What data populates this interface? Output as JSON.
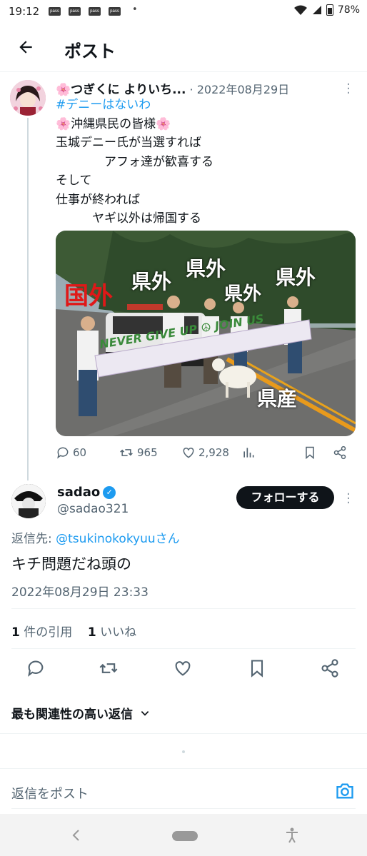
{
  "status_bar": {
    "time": "19:12",
    "notification_icons": [
      "pass",
      "pass",
      "pass",
      "pass"
    ],
    "dot": "•",
    "battery": "78%"
  },
  "header": {
    "title": "ポスト"
  },
  "tweet1": {
    "emoji": "🌸",
    "name": "つぎくに よりいち...",
    "separator": " · ",
    "date": "2022年08月29日",
    "lines": [
      "#デニーはないわ",
      "🌸沖縄県民の皆様🌸",
      "玉城デニー氏が当選すれば",
      "　　　　アフォ達が歓喜する",
      "そして",
      "仕事が終われば",
      "　　　ヤギ以外は帰国する"
    ],
    "photo": {
      "label_red": "国外",
      "labels_white": [
        "県外",
        "県外",
        "県外",
        "県外"
      ],
      "label_bottom": "県産",
      "banner": "NEVER GIVE UP ☮ JOIN US"
    },
    "stats": {
      "replies": "60",
      "reposts": "965",
      "likes": "2,928"
    }
  },
  "tweet2": {
    "name": "sadao",
    "handle": "@sadao321",
    "follow_label": "フォローする",
    "reply_prefix": "返信先: ",
    "reply_target": "@tsukinokokyuuさん",
    "text": "キチ問題だね頭の",
    "timestamp": "2022年08月29日 23:33",
    "quotes_count": "1",
    "quotes_label": " 件の引用",
    "likes_count": "1",
    "likes_label": " いいね"
  },
  "sort_label": "最も関連性の高い返信",
  "reply_placeholder": "返信をポスト",
  "colors": {
    "accent": "#1d9bf0",
    "text": "#0f1419",
    "muted": "#536471"
  }
}
